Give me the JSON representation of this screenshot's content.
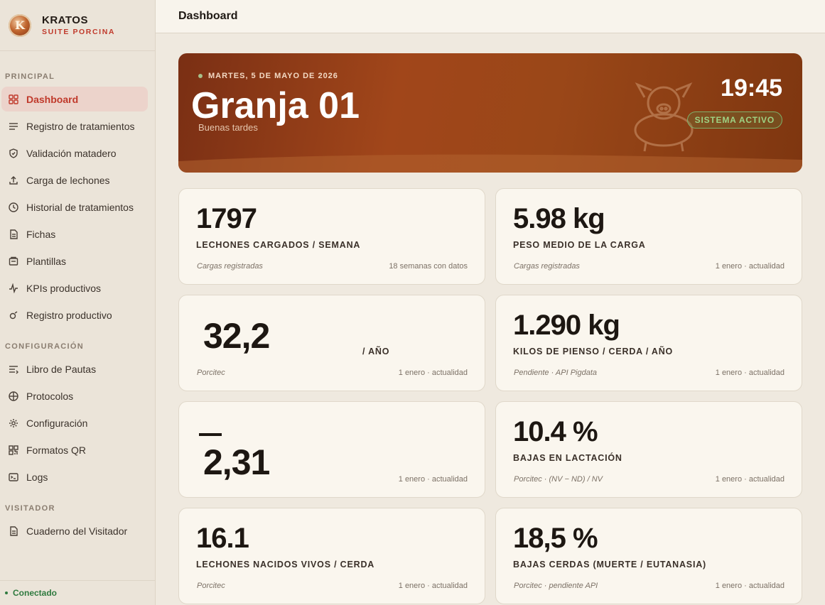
{
  "brand": {
    "name": "KRATOS",
    "subtitle": "SUITE PORCINA",
    "logo_letter": "K"
  },
  "sidebar": {
    "sections": [
      "PRINCIPAL",
      "CONFIGURACIÓN",
      "VISITADOR"
    ],
    "principal": [
      {
        "label": "Dashboard",
        "icon": "grid-icon",
        "active": true
      },
      {
        "label": "Registro de tratamientos",
        "icon": "list-icon"
      },
      {
        "label": "Validación matadero",
        "icon": "shield-check-icon"
      },
      {
        "label": "Carga de lechones",
        "icon": "upload-icon"
      },
      {
        "label": "Historial de tratamientos",
        "icon": "clock-icon"
      },
      {
        "label": "Fichas",
        "icon": "file-icon"
      },
      {
        "label": "Plantillas",
        "icon": "template-icon"
      },
      {
        "label": "KPIs productivos",
        "icon": "activity-icon"
      },
      {
        "label": "Registro productivo",
        "icon": "pig-icon"
      }
    ],
    "configuracion": [
      {
        "label": "Libro de Pautas",
        "icon": "book-icon"
      },
      {
        "label": "Protocolos",
        "icon": "protocol-icon"
      },
      {
        "label": "Configuración",
        "icon": "gear-icon"
      },
      {
        "label": "Formatos QR",
        "icon": "qr-icon"
      },
      {
        "label": "Logs",
        "icon": "terminal-icon"
      }
    ],
    "visitador": [
      {
        "label": "Cuaderno del Visitador",
        "icon": "notebook-icon"
      }
    ],
    "status": "Conectado"
  },
  "header": {
    "title": "Dashboard"
  },
  "hero": {
    "date": "MARTES, 5 DE MAYO DE 2026",
    "title": "Granja 01",
    "greeting": "Buenas tardes",
    "time": "19:45",
    "badge": "SISTEMA ACTIVO"
  },
  "cards": [
    {
      "value": "1797",
      "label": "LECHONES CARGADOS / SEMANA",
      "source": "Cargas registradas",
      "range": "18 semanas con datos"
    },
    {
      "value": "5.98 kg",
      "label": "PESO MEDIO DE LA CARGA",
      "source": "Cargas registradas",
      "range": "1 enero · actualidad"
    },
    {
      "value": "32,2",
      "label": "/ AÑO",
      "source": "Porcitec",
      "range": "1 enero · actualidad"
    },
    {
      "value": "1.290 kg",
      "label": "KILOS DE PIENSO / CERDA / AÑO",
      "source": "Pendiente · API Pigdata",
      "range": "1 enero · actualidad"
    },
    {
      "value": "2,31",
      "label": "",
      "source": "",
      "range": "1 enero · actualidad"
    },
    {
      "value": "10.4 %",
      "label": "BAJAS EN LACTACIÓN",
      "source": "Porcitec · (NV − ND) / NV",
      "range": "1 enero · actualidad"
    },
    {
      "value": "16.1",
      "label": "LECHONES NACIDOS VIVOS / CERDA",
      "source": "Porcitec",
      "range": "1 enero · actualidad"
    },
    {
      "value": "18,5 %",
      "label": "BAJAS CERDAS (MUERTE / EUTANASIA)",
      "source": "Porcitec · pendiente API",
      "range": "1 enero · actualidad"
    }
  ],
  "colors": {
    "accent": "#c0392b",
    "active_bg": "#ecd3cb",
    "connected": "#2f7a3f",
    "hero": "#9a4718"
  }
}
